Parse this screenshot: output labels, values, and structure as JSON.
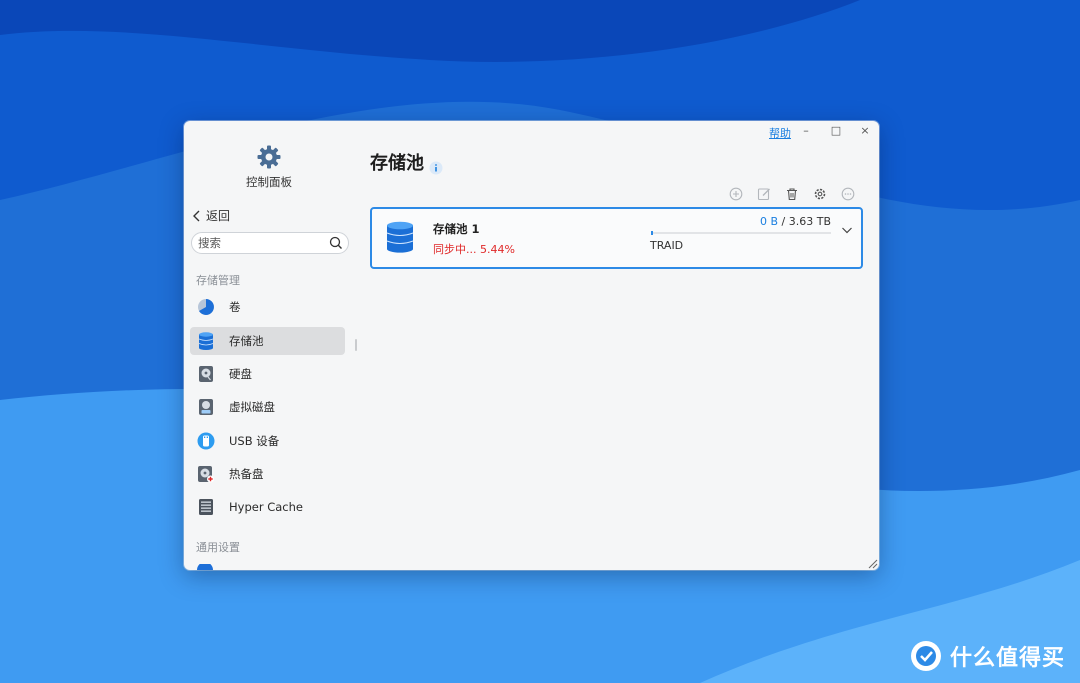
{
  "window": {
    "help_label": "帮助",
    "minimize_label": "–",
    "maximize_label": "□",
    "close_label": "×"
  },
  "sidebar": {
    "title": "控制面板",
    "back_label": "返回",
    "search_placeholder": "搜索",
    "sections": [
      {
        "label": "存储管理",
        "items": [
          {
            "label": "卷",
            "icon": "pie-chart-icon"
          },
          {
            "label": "存储池",
            "icon": "database-icon",
            "active": true
          },
          {
            "label": "硬盘",
            "icon": "hard-drive-icon"
          },
          {
            "label": "虚拟磁盘",
            "icon": "virtual-disk-icon"
          },
          {
            "label": "USB 设备",
            "icon": "usb-icon"
          },
          {
            "label": "热备盘",
            "icon": "hot-spare-icon"
          },
          {
            "label": "Hyper Cache",
            "icon": "cache-icon"
          }
        ]
      },
      {
        "label": "通用设置",
        "items": []
      }
    ]
  },
  "main": {
    "title": "存储池",
    "toolbar": [
      "add-icon",
      "edit-icon",
      "delete-icon",
      "settings-icon",
      "more-icon"
    ],
    "pools": [
      {
        "name": "存储池 1",
        "status": "同步中... 5.44%",
        "used": "0 B",
        "separator": " / ",
        "total": "3.63 TB",
        "raid": "TRAID",
        "usage_fraction": 0
      }
    ]
  },
  "watermark": {
    "text": "什么值得买"
  },
  "colors": {
    "accent": "#2d8ae6",
    "status_red": "#e02828",
    "background_blue": "#1f6fd6"
  }
}
